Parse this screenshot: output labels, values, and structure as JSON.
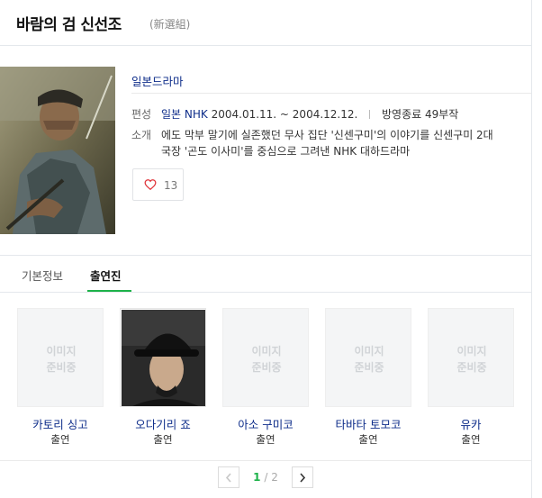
{
  "header": {
    "title": "바람의 검 신선조",
    "subtitle": "(新選組)"
  },
  "info": {
    "genre": "일본드라마",
    "schedule_label": "편성",
    "broadcaster": "일본 NHK",
    "dates": "2004.01.11. ~ 2004.12.12.",
    "status": "방영종료 49부작",
    "summary_label": "소개",
    "summary_line1": "에도 막부 말기에 실존했던 무사 집단 '신센구미'의 이야기를 신센구미 2대",
    "summary_line2": "국장 '곤도 이사미'를 중심으로 그려낸 NHK 대하드라마"
  },
  "like": {
    "count": "13",
    "icon": "heart-icon"
  },
  "tabs": [
    {
      "label": "기본정보",
      "active": false
    },
    {
      "label": "출연진",
      "active": true
    }
  ],
  "cast": [
    {
      "name": "카토리 싱고",
      "role": "출연",
      "placeholder": [
        "이미지",
        "준비중"
      ],
      "has_photo": false
    },
    {
      "name": "오다기리 죠",
      "role": "출연",
      "placeholder": [
        "",
        ""
      ],
      "has_photo": true
    },
    {
      "name": "아소 구미코",
      "role": "출연",
      "placeholder": [
        "이미지",
        "준비중"
      ],
      "has_photo": false
    },
    {
      "name": "타바타 토모코",
      "role": "출연",
      "placeholder": [
        "이미지",
        "준비중"
      ],
      "has_photo": false
    },
    {
      "name": "유카",
      "role": "출연",
      "placeholder": [
        "이미지",
        "준비중"
      ],
      "has_photo": false
    }
  ],
  "pager": {
    "current": "1",
    "separator": "/",
    "total": "2"
  },
  "colors": {
    "accent": "#1eb24a",
    "link": "#0e2d8a",
    "heart": "#e0353b"
  }
}
